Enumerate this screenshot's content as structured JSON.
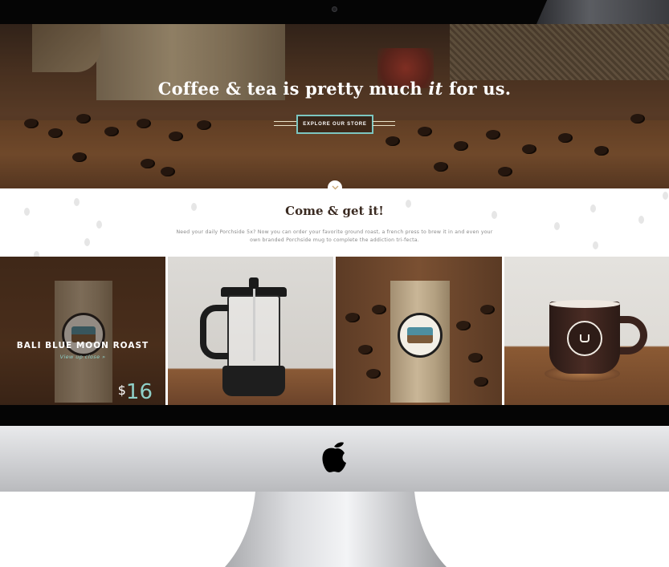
{
  "hero": {
    "title_pre": "Coffee & tea is pretty much ",
    "title_em": "it",
    "title_post": " for us.",
    "cta_label": "EXPLORE OUR STORE"
  },
  "promo": {
    "title": "Come & get it!",
    "text": "Need your daily Porchside 5x? Now you can order your favorite ground roast, a french press to brew it in and even your own branded Porchside mug to complete the addiction tri-fecta."
  },
  "products": {
    "featured": {
      "name": "BALI BLUE MOON ROAST",
      "link": "View up close »",
      "currency": "$",
      "price": "16"
    }
  },
  "icons": {
    "scroll": "chevron-down-icon",
    "brand": "apple-logo-icon"
  },
  "colors": {
    "accent": "#7cc6c0",
    "price": "#8fd0c8",
    "heading": "#3b2b22"
  }
}
